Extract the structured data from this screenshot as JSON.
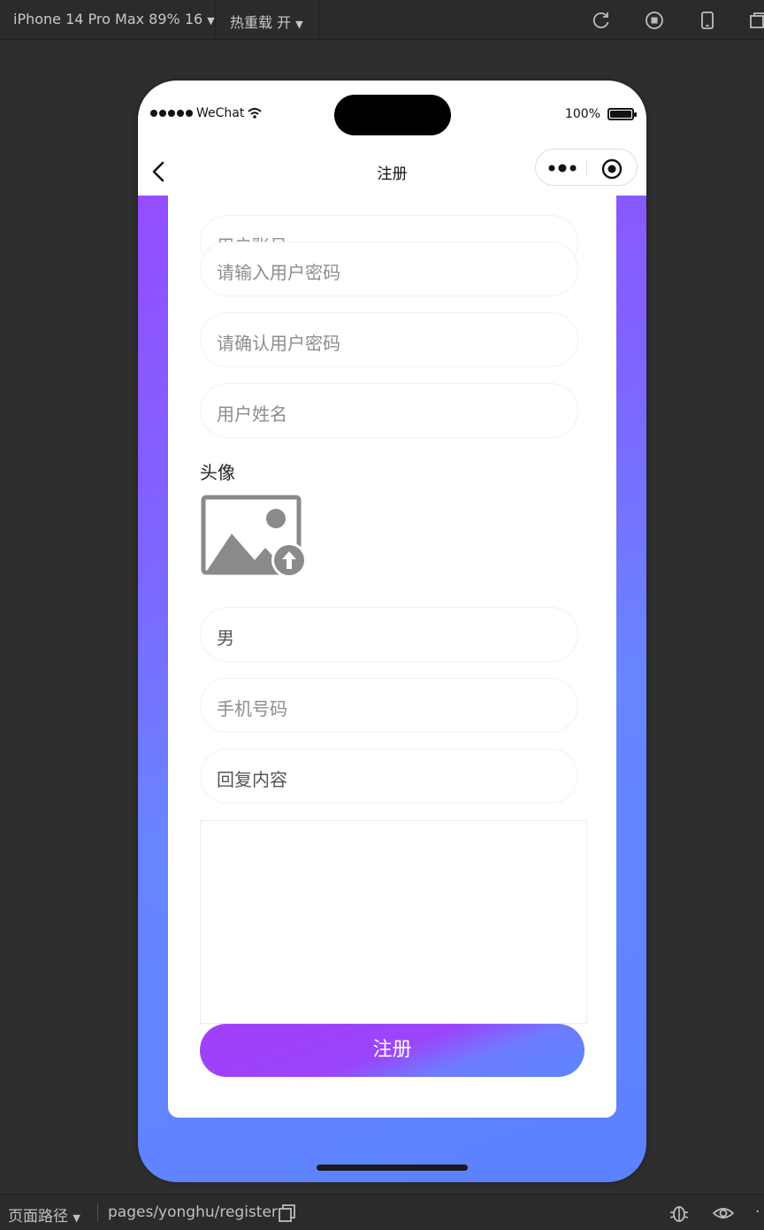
{
  "devtools": {
    "device_label": "iPhone 14 Pro Max 89% 16",
    "hot_reload_label": "热重载 开",
    "path_label": "页面路径",
    "page_path": "pages/yonghu/register"
  },
  "status_bar": {
    "carrier": "WeChat",
    "battery": "100%"
  },
  "navbar": {
    "title": "注册"
  },
  "form": {
    "account_placeholder": "用户账号",
    "password_placeholder": "请输入用户密码",
    "confirm_password_placeholder": "请确认用户密码",
    "name_placeholder": "用户姓名",
    "avatar_label": "头像",
    "gender_value": "男",
    "phone_placeholder": "手机号码",
    "reply_placeholder": "回复内容",
    "submit_label": "注册"
  },
  "colors": {
    "gradient_start": "#9a45ff",
    "gradient_end": "#5b82ff"
  }
}
